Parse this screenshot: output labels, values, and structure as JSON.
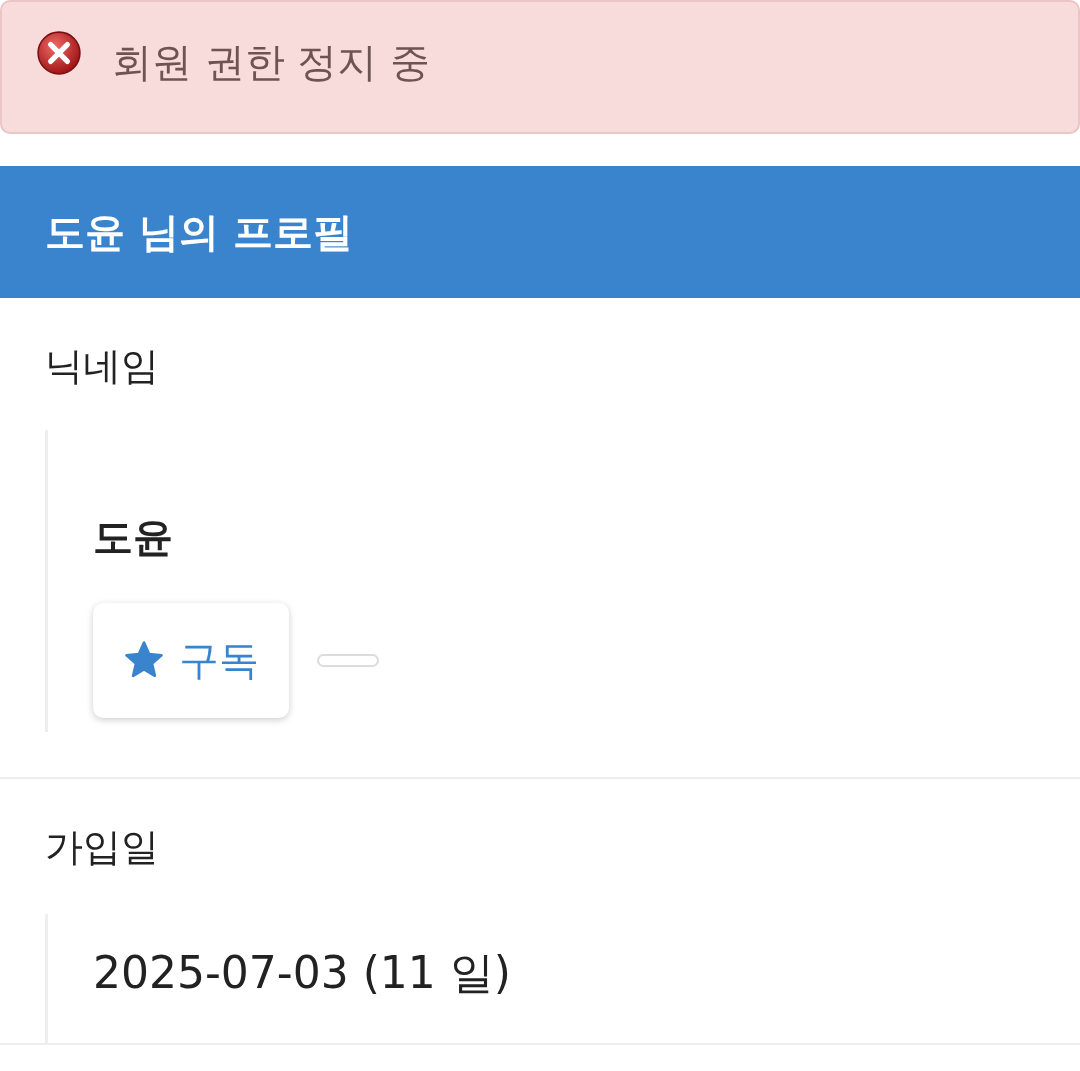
{
  "alert": {
    "kind": "error",
    "message": "회원 권한 정지 중"
  },
  "header": {
    "title": "도윤 님의 프로필"
  },
  "sections": [
    {
      "label": "닉네임",
      "kind": "nickname",
      "value": "도윤",
      "subscribe_button": {
        "label": "구독"
      }
    },
    {
      "label": "가입일",
      "kind": "text",
      "value": "2025-07-03 (11 일)"
    }
  ]
}
